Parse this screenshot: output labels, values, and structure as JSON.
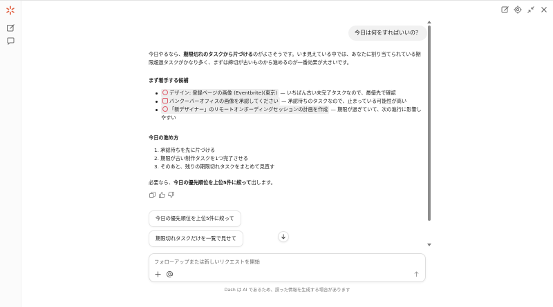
{
  "app": {
    "accent": "#e05a3a"
  },
  "rail": {
    "logo_icon": "dash-logo-icon",
    "items": [
      {
        "icon": "new-chat-icon"
      },
      {
        "icon": "chat-history-icon"
      }
    ]
  },
  "toolbar": {
    "icons": [
      "compose-icon",
      "gear-icon",
      "collapse-icon",
      "close-icon"
    ]
  },
  "user_message": "今日は何をすればいいの？",
  "answer": {
    "intro_1": "今日やるなら、",
    "intro_bold": "期限切れのタスクから片づける",
    "intro_2": "のがよさそうです。いま見えている中では、あなたに割り当てられている期限超過タスクがかなり多く、まずは締切が古いものから進めるのが一番効果が大きいです。",
    "section1_title": "まず着手する候補",
    "candidates": [
      {
        "icon": "check-circle-icon",
        "chip": "デザイン: 登録ページの画像 (Eventbrite)(東京)",
        "note": " — いちばん古い未完了タスクなので、最優先で確認"
      },
      {
        "icon": "person-icon",
        "chip": "バンクーバーオフィスの画像を承認してください",
        "note": " — 承認待ちのタスクなので、止まっている可能性が高い"
      },
      {
        "icon": "octagon-icon",
        "chip": "「新デザイナー」のリモートオンボーディングセッションの計画を作成",
        "note": " — 期限が過ぎていて、次の進行に影響しやすい"
      }
    ],
    "section2_title": "今日の進め方",
    "steps": [
      "1. 承認待ちを先に片づける",
      "2. 期限が古い制作タスクを1つ完了させる",
      "3. そのあと、残りの期限切れタスクをまとめて見直す"
    ],
    "closing_1": "必要なら、",
    "closing_bold": "今日の優先順位を上位5件に絞って",
    "closing_2": "出します。"
  },
  "feedback_icons": [
    "copy-icon",
    "thumbs-up-icon",
    "thumbs-down-icon"
  ],
  "suggestions": [
    "今日の優先順位を上位5件に絞って",
    "期限切れタスクだけを一覧で見せて"
  ],
  "composer": {
    "placeholder": "フォローアップまたは新しいリクエストを開始",
    "icons": [
      "plus-icon",
      "mention-icon",
      "send-icon"
    ]
  },
  "disclaimer": "Dash は AI であるため、誤った情報を生成する場合があります"
}
